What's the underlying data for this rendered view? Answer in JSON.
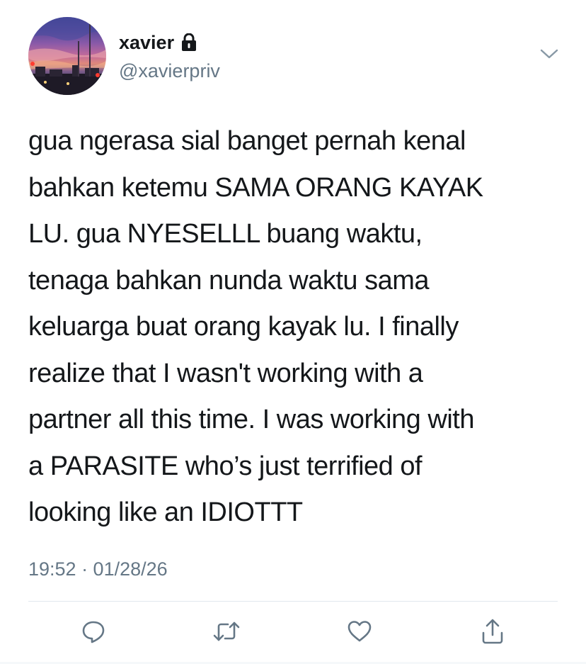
{
  "user": {
    "display_name": "xavier",
    "handle": "@xavierpriv",
    "protected_icon": "lock-icon",
    "avatar": "sunset-sky-photo"
  },
  "tweet": {
    "lines": [
      "gua ngerasa sial banget pernah kenal",
      "bahkan ketemu SAMA ORANG KAYAK",
      "LU. gua NYESELLL buang waktu,",
      "tenaga bahkan nunda waktu sama",
      "keluarga buat orang kayak lu. I finally",
      "realize that I wasn't working with a",
      "partner all this time. I was working with",
      "a PARASITE who’s just terrified of",
      "looking like an IDIOTTT"
    ],
    "timestamp": "19:52 · 01/28/26"
  },
  "actions": [
    {
      "name": "reply-button",
      "icon": "speech-bubble-icon"
    },
    {
      "name": "retweet-button",
      "icon": "retweet-icon"
    },
    {
      "name": "like-button",
      "icon": "heart-icon"
    },
    {
      "name": "share-button",
      "icon": "share-icon"
    }
  ],
  "colors": {
    "text": "#14171a",
    "secondary": "#657786",
    "divider": "#e1e8ed"
  }
}
